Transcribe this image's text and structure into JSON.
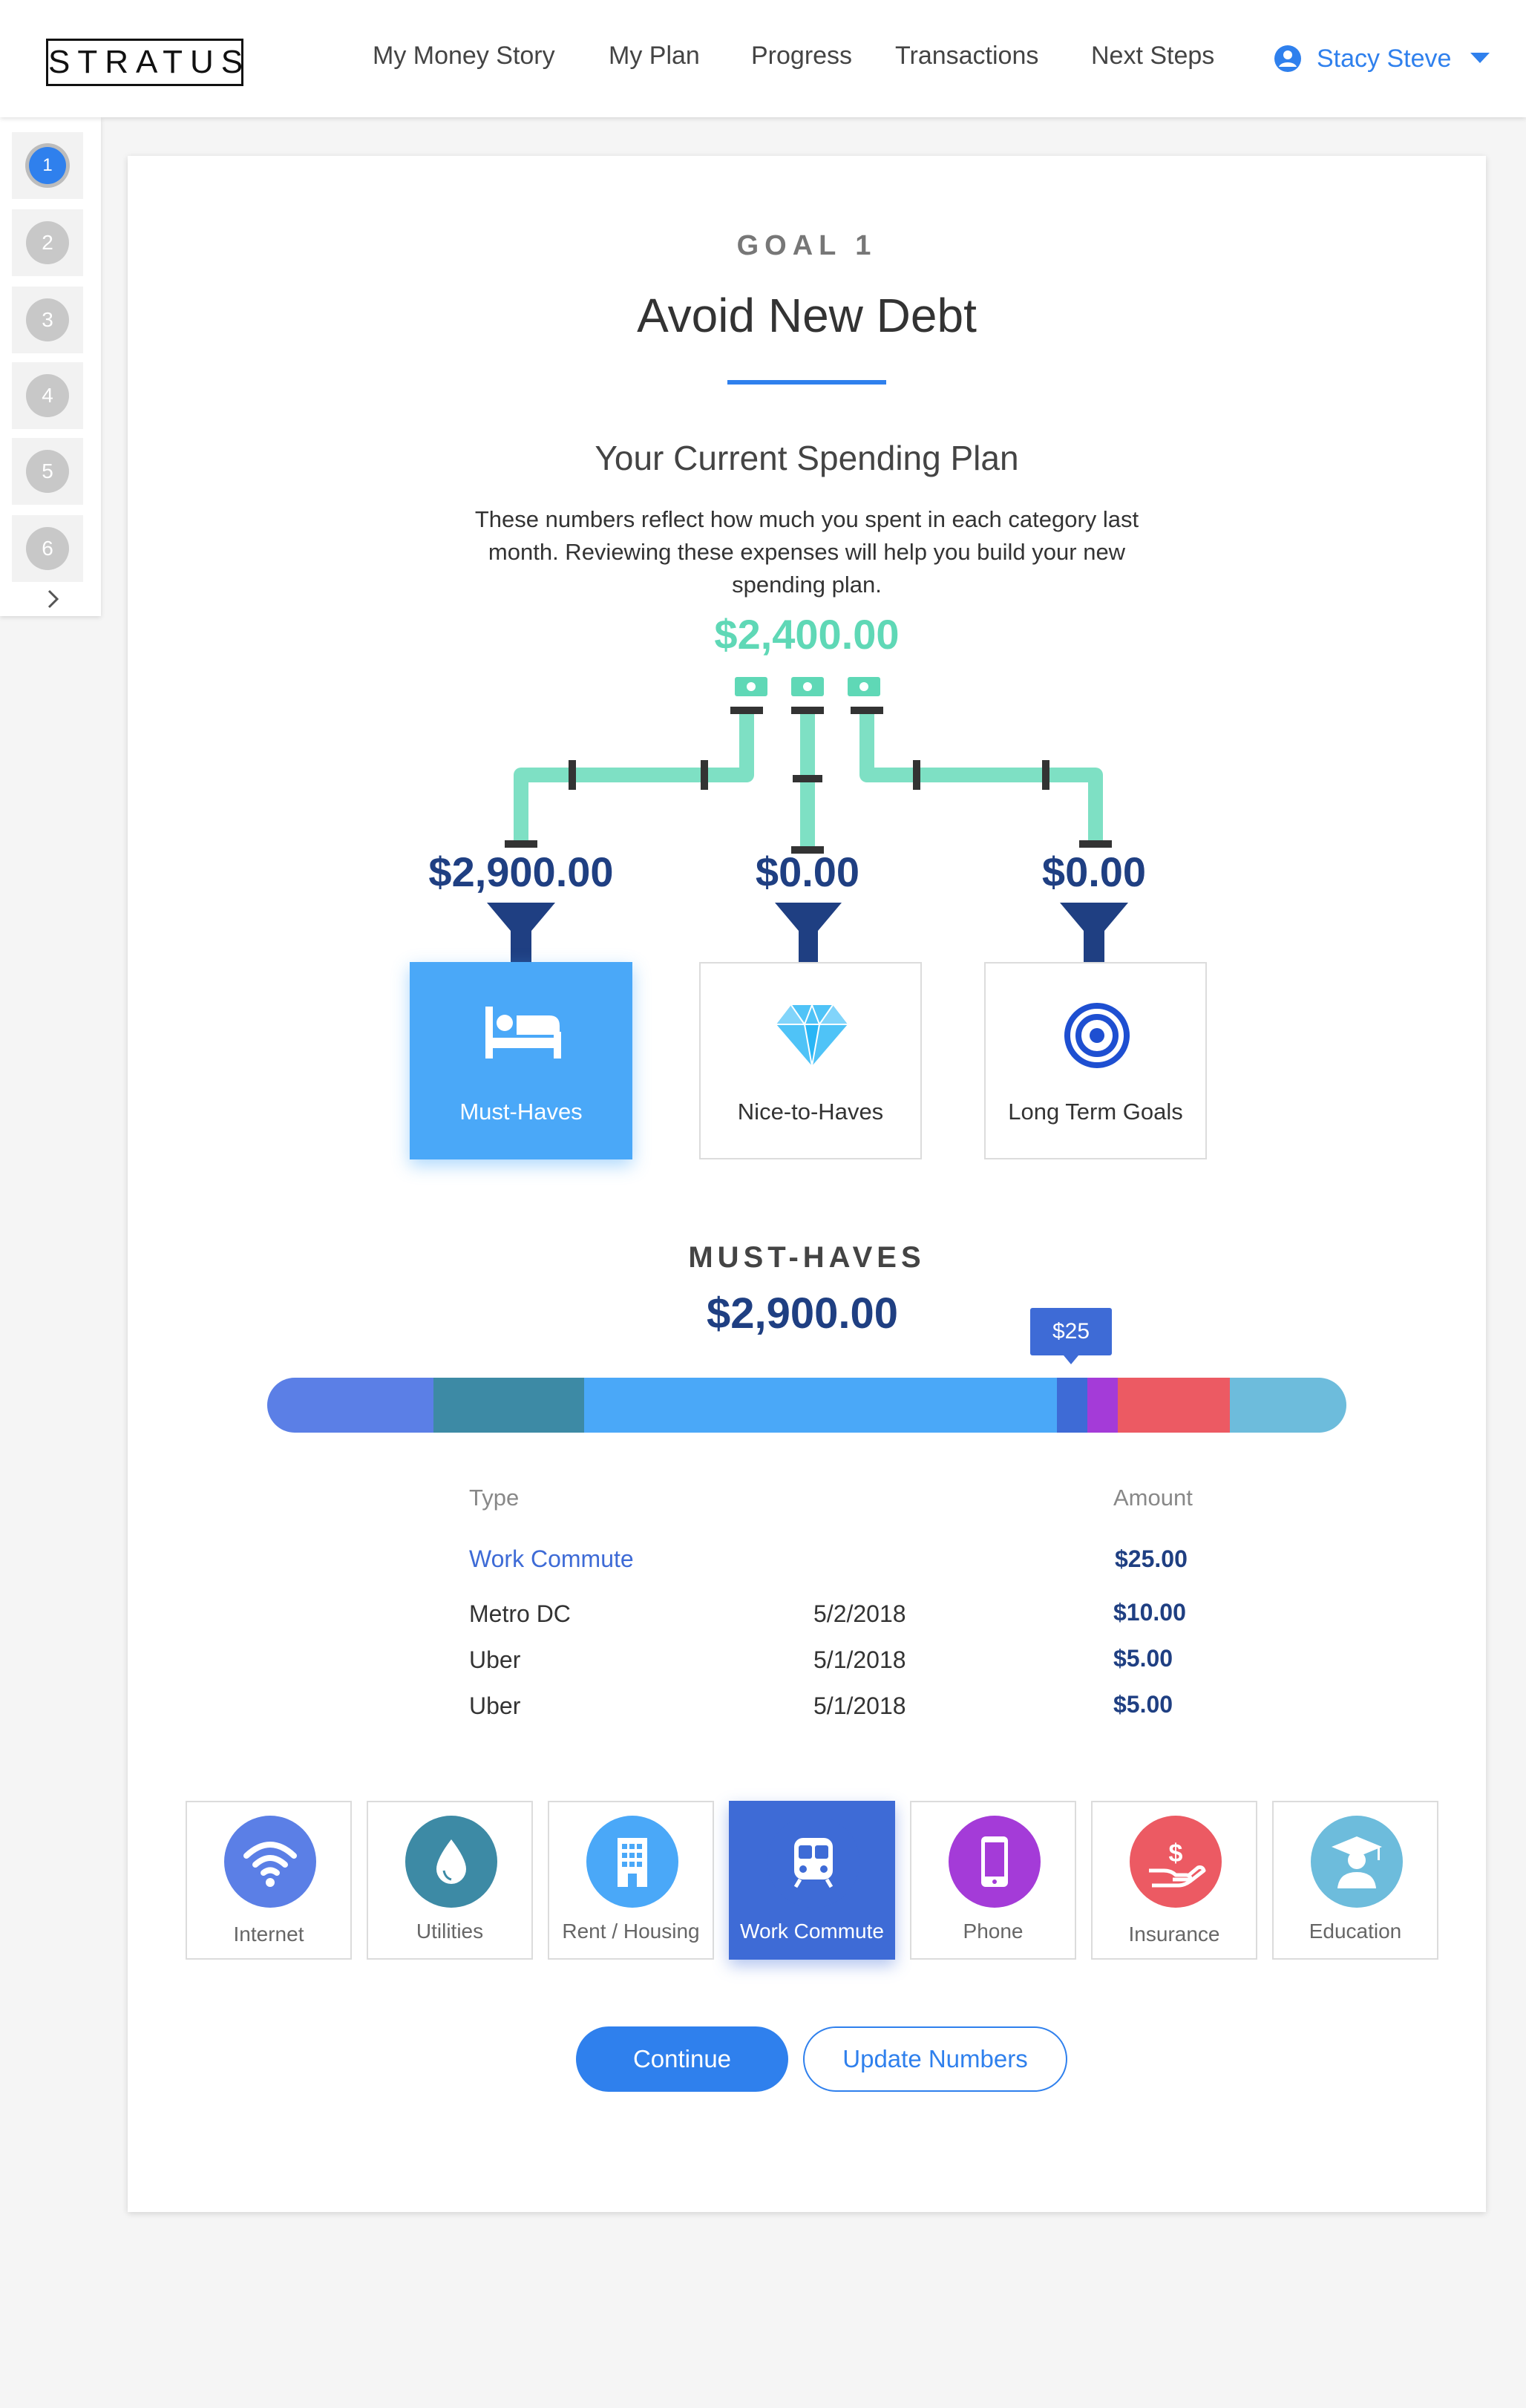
{
  "header": {
    "logo": "STRATUS",
    "nav": [
      "My Money Story",
      "My Plan",
      "Progress",
      "Transactions",
      "Next Steps"
    ],
    "user": "Stacy Steve",
    "accent": "#2f80ed"
  },
  "rail": {
    "steps": [
      "1",
      "2",
      "3",
      "4",
      "5",
      "6"
    ],
    "active_step": "1",
    "next_icon": "chevron-right-icon"
  },
  "goal": {
    "label": "GOAL 1",
    "title": "Avoid New Debt"
  },
  "plan": {
    "title": "Your Current Spending Plan",
    "description": "These numbers reflect how much you spent in each category last month. Reviewing these expenses will help you build your new spending plan.",
    "total": "$2,400.00"
  },
  "buckets": [
    {
      "amount": "$2,900.00",
      "label": "Must-Haves",
      "icon": "bed-icon",
      "selected": true
    },
    {
      "amount": "$0.00",
      "label": "Nice-to-Haves",
      "icon": "diamond-icon",
      "selected": false
    },
    {
      "amount": "$0.00",
      "label": "Long Term Goals",
      "icon": "target-icon",
      "selected": false
    }
  ],
  "must_haves": {
    "label": "MUST-HAVES",
    "amount": "$2,900.00",
    "tooltip": "$25",
    "bar_segments": [
      {
        "color": "#5b7fe6",
        "share": 0.154
      },
      {
        "color": "#3d8aa5",
        "share": 0.14
      },
      {
        "color": "#4aa8f8",
        "share": 0.438
      },
      {
        "color": "#3e6bd6",
        "share": 0.028
      },
      {
        "color": "#a43bd8",
        "share": 0.028
      },
      {
        "color": "#ec5a63",
        "share": 0.104
      },
      {
        "color": "#6dbcdc",
        "share": 0.108
      }
    ]
  },
  "table": {
    "headers": {
      "type": "Type",
      "amount": "Amount"
    },
    "category": {
      "name": "Work Commute",
      "amount": "$25.00"
    },
    "rows": [
      {
        "name": "Metro DC",
        "date": "5/2/2018",
        "amount": "$10.00"
      },
      {
        "name": "Uber",
        "date": "5/1/2018",
        "amount": "$5.00"
      },
      {
        "name": "Uber",
        "date": "5/1/2018",
        "amount": "$5.00"
      }
    ]
  },
  "categories": [
    {
      "label": "Internet",
      "icon": "wifi-icon",
      "color": "#5b7fe6"
    },
    {
      "label": "Utilities",
      "icon": "water-drop-icon",
      "color": "#3d8aa5"
    },
    {
      "label": "Rent / Housing",
      "icon": "building-icon",
      "color": "#4aa8f8"
    },
    {
      "label": "Work Commute",
      "icon": "train-icon",
      "color": "#3e6bd6",
      "selected": true
    },
    {
      "label": "Phone",
      "icon": "phone-icon",
      "color": "#a43bd8"
    },
    {
      "label": "Insurance",
      "icon": "insurance-hand-icon",
      "color": "#ec5a63"
    },
    {
      "label": "Education",
      "icon": "graduate-icon",
      "color": "#6dbcdc"
    }
  ],
  "actions": {
    "continue": "Continue",
    "update": "Update Numbers"
  }
}
